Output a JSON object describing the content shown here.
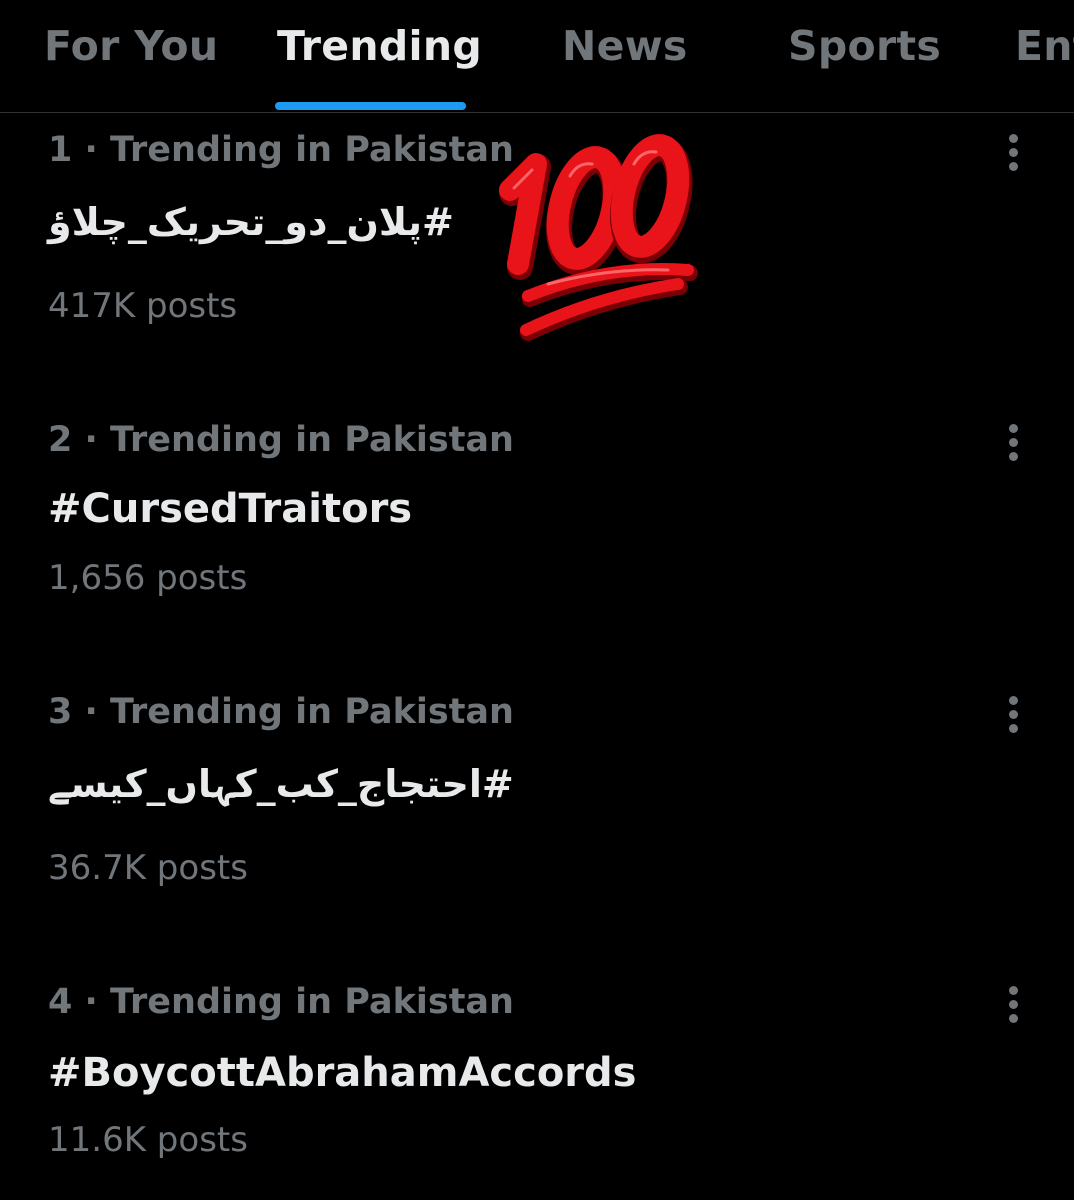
{
  "tabs": [
    {
      "label": "For You",
      "active": false
    },
    {
      "label": "Trending",
      "active": true
    },
    {
      "label": "News",
      "active": false
    },
    {
      "label": "Sports",
      "active": false
    },
    {
      "label": "Entertainment",
      "active": false
    }
  ],
  "trends": [
    {
      "meta": "1 · Trending in Pakistan",
      "name": "#پلان_دو_تحریک_چلاؤ",
      "posts": "417K posts"
    },
    {
      "meta": "2 · Trending in Pakistan",
      "name": "#CursedTraitors",
      "posts": "1,656 posts"
    },
    {
      "meta": "3 · Trending in Pakistan",
      "name": "#احتجاج_کب_کہاں_کیسے",
      "posts": "36.7K posts"
    },
    {
      "meta": "4 · Trending in Pakistan",
      "name": "#BoycottAbrahamAccords",
      "posts": "11.6K posts"
    }
  ],
  "overlay": {
    "icon": "hundred-points-emoji",
    "color": "#e8141a"
  },
  "colors": {
    "background": "#000000",
    "primary_text": "#e7e9ea",
    "secondary_text": "#71767b",
    "accent": "#1d9bf0",
    "divider": "#2f3336"
  }
}
